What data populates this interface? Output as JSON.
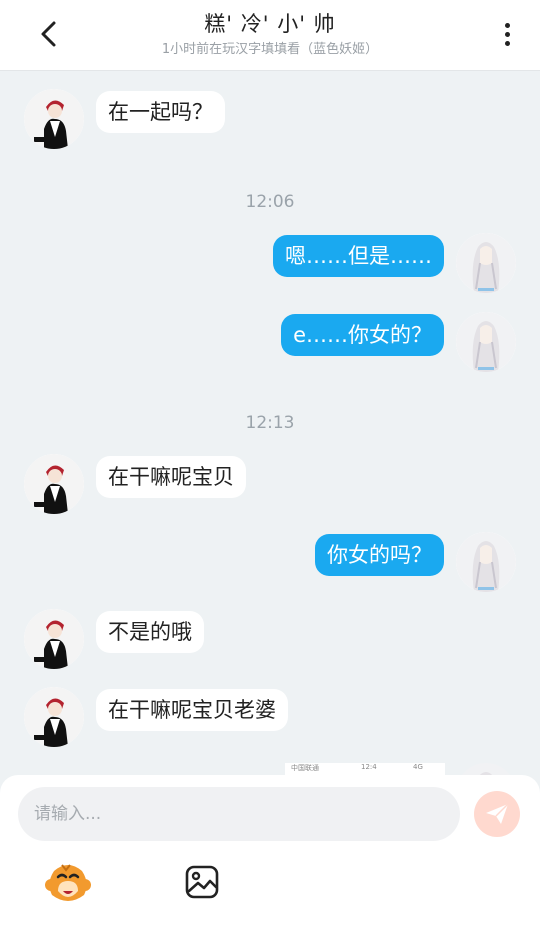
{
  "header": {
    "title": "糕' 冷' 小' 帅",
    "subtitle": "1小时前在玩汉字填填看（蓝色妖姬）"
  },
  "colors": {
    "outgoing_bubble": "#1aa9f0",
    "incoming_bubble": "#ffffff",
    "chat_background": "#eef2f4",
    "send_button": "#ffd9cf"
  },
  "messages": [
    {
      "side": "in",
      "text": "在一起吗？"
    },
    {
      "type": "time",
      "text": "12:06"
    },
    {
      "side": "out",
      "text": "嗯……但是……"
    },
    {
      "side": "out",
      "text": "e……你女的？"
    },
    {
      "type": "time",
      "text": "12:13"
    },
    {
      "side": "in",
      "text": "在干嘛呢宝贝"
    },
    {
      "side": "out",
      "text": "你女的吗？"
    },
    {
      "side": "in",
      "text": "不是的哦"
    },
    {
      "side": "in",
      "text": "在干嘛呢宝贝老婆"
    }
  ],
  "peek_message": {
    "carrier": "中国联通",
    "time": "12:4",
    "status": "4G"
  },
  "composer": {
    "placeholder": "请输入...",
    "send_icon": "paper-plane-icon",
    "emoji_icon": "monkey-face-icon",
    "image_icon": "image-icon"
  }
}
